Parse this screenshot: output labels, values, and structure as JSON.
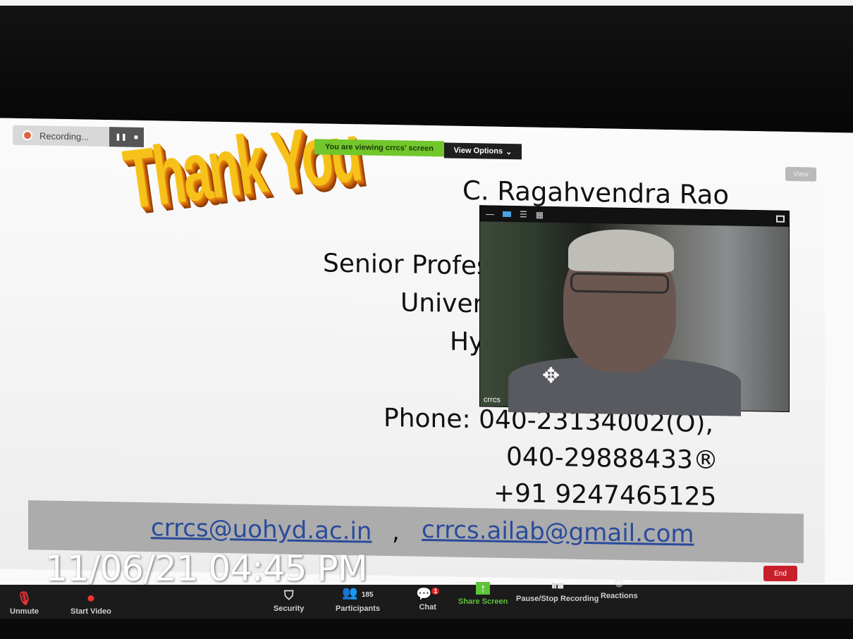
{
  "recording": {
    "label": "Recording..."
  },
  "banner": {
    "viewing_text": "You are viewing crrcs' screen",
    "view_options": "View Options",
    "view_button": "View"
  },
  "slide": {
    "thank_you": "Thank You",
    "name": "C. Ragahvendra Rao",
    "title_line": "Senior Profes",
    "univ_line": "Univer",
    "city_line": "Hy",
    "phone_line1": "Phone: 040-23134002(O),",
    "phone_line2": "040-29888433®",
    "phone_line3": "+91 9247465125",
    "email1": "crrcs@uohyd.ac.in",
    "email_sep": ",",
    "email2": "crrcs.ailab@gmail.com"
  },
  "video": {
    "participant_name": "crrcs"
  },
  "toolbar": {
    "unmute": "Unmute",
    "start_video": "Start Video",
    "security": "Security",
    "participants": "Participants",
    "participants_count": "185",
    "chat": "Chat",
    "chat_badge": "1",
    "share_screen": "Share Screen",
    "pause_stop_recording": "Pause/Stop Recording",
    "reactions": "Reactions",
    "end": "End"
  },
  "overlay": {
    "timestamp": "11/06/21 04:45 PM"
  },
  "colors": {
    "share_green": "#5cc33a",
    "end_red": "#c8202a",
    "banner_green": "#72c72c"
  },
  "icons": [
    "record-icon",
    "pause-icon",
    "stop-icon",
    "mic-off-icon",
    "video-off-icon",
    "shield-icon",
    "participants-icon",
    "chat-icon",
    "share-icon",
    "reactions-icon",
    "move-icon"
  ]
}
